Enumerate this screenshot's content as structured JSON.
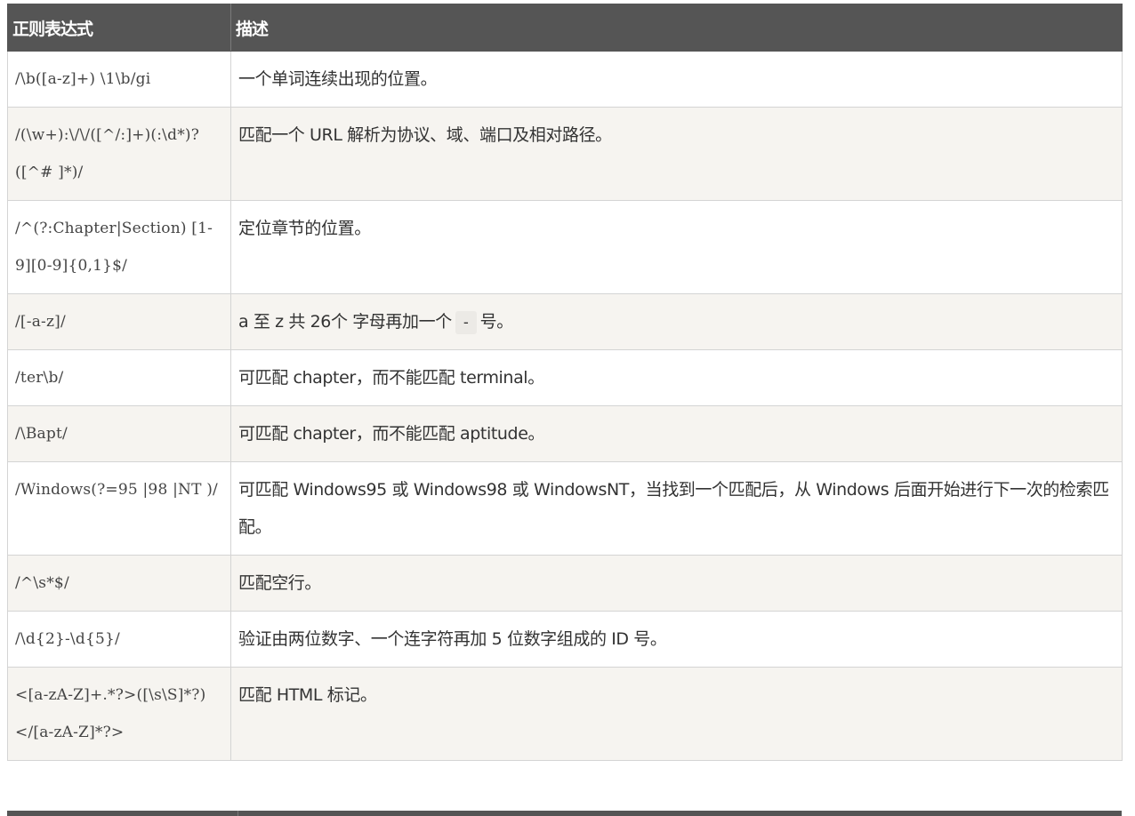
{
  "table": {
    "headers": [
      "正则表达式",
      "描述"
    ],
    "rows": [
      {
        "regex": "/\\b([a-z]+) \\1\\b/gi",
        "desc": "一个单词连续出现的位置。"
      },
      {
        "regex": "/(\\w+):\\/\\/([^/:]+)(:\\d*)?([^# ]*)/",
        "desc": "匹配一个 URL 解析为协议、域、端口及相对路径。"
      },
      {
        "regex": "/^(?:Chapter|Section) [1-9][0-9]{0,1}$/",
        "desc": "定位章节的位置。"
      },
      {
        "regex": "/[-a-z]/",
        "desc_before": "a 至 z 共 26个 字母再加一个",
        "desc_code": "-",
        "desc_after": "号。"
      },
      {
        "regex": "/ter\\b/",
        "desc": "可匹配 chapter，而不能匹配 terminal。"
      },
      {
        "regex": "/\\Bapt/",
        "desc": "可匹配 chapter，而不能匹配 aptitude。"
      },
      {
        "regex": "/Windows(?=95 |98 |NT )/",
        "desc": "可匹配 Windows95 或 Windows98 或 WindowsNT，当找到一个匹配后，从 Windows 后面开始进行下一次的检索匹配。"
      },
      {
        "regex": "/^\\s*$/",
        "desc": "匹配空行。"
      },
      {
        "regex": "/\\d{2}-\\d{5}/",
        "desc": "验证由两位数字、一个连字符再加 5 位数字组成的 ID 号。"
      },
      {
        "regex": "<[a-zA-Z]+.*?>([\\s\\S]*?)</[a-zA-Z]*?>",
        "desc": "匹配 HTML 标记。"
      }
    ]
  }
}
